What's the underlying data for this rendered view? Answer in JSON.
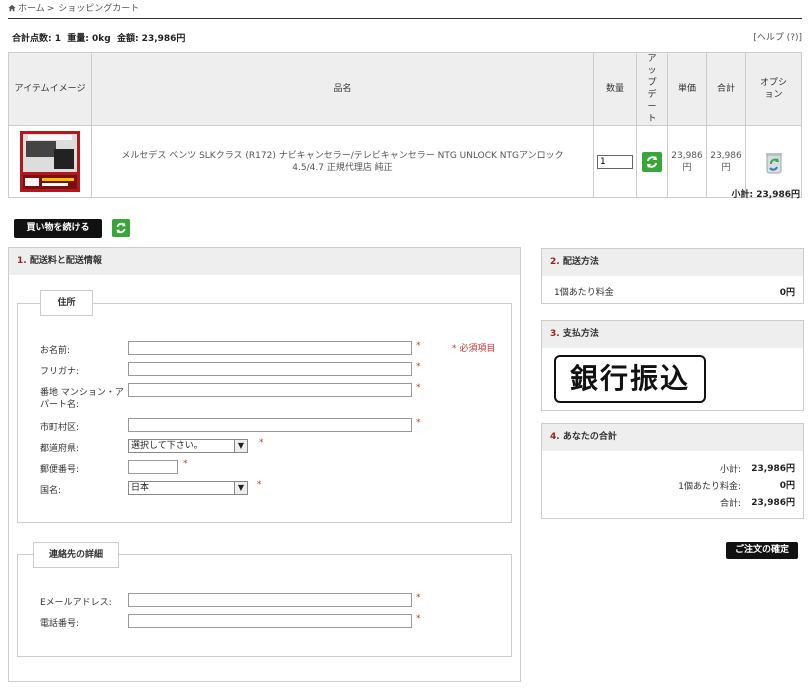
{
  "breadcrumb": {
    "home": "ホーム",
    "separator": ">",
    "current": "ショッピングカート"
  },
  "summary": {
    "text": "合計点数: 1  重量: 0kg  金額: 23,986円"
  },
  "help": {
    "label": "[ヘルプ (?)]"
  },
  "cart": {
    "headers": {
      "image": "アイテムイメージ",
      "name": "品名",
      "qty": "数量",
      "update": "アップデート",
      "unit_price": "単価",
      "total": "合計",
      "option": "オプション"
    },
    "rows": [
      {
        "name": "メルセデス ベンツ SLKクラス (R172) ナビキャンセラー/テレビキャンセラー NTG UNLOCK NTGアンロック 4.5/4.7 正規代理店 純正",
        "qty": "1",
        "unit_price": "23,986円",
        "total": "23,986円"
      }
    ],
    "subtotal": "小計: 23,986円"
  },
  "continue_shopping": {
    "label": "買い物を続ける"
  },
  "shipping": {
    "num": "1.",
    "title": "配送料と配送情報",
    "address_legend": "住所",
    "required_note": "* 必須項目",
    "required_mark": "*",
    "fields": {
      "name": "お名前:",
      "furigana": "フリガナ:",
      "address_line": "番地 マンション・アパート名:",
      "city": "市町村区:",
      "prefecture": "都道府県:",
      "postal": "郵便番号:",
      "country": "国名:"
    },
    "prefecture_value": "選択して下さい。",
    "country_value": "日本",
    "contact_legend": "連絡先の詳細",
    "contact_fields": {
      "email": "Eメールアドレス:",
      "phone": "電話番号:"
    }
  },
  "delivery": {
    "num": "2.",
    "title": "配送方法",
    "rate_label": "1個あたり料金",
    "rate_value": "0円"
  },
  "payment": {
    "num": "3.",
    "title": "支払方法",
    "method": "銀行振込"
  },
  "totals": {
    "num": "4.",
    "title": "あなたの合計",
    "subtotal_label": "小計:",
    "subtotal_value": "23,986円",
    "shipping_label": "1個あたり料金:",
    "shipping_value": "0円",
    "total_label": "合計:",
    "total_value": "23,986円"
  },
  "place_order": {
    "label": "ご注文の確定"
  },
  "colors": {
    "accent_red": "#9a2020",
    "button_black": "#111111",
    "header_gray": "#eeeeee",
    "refresh_green": "#3aa63a"
  }
}
